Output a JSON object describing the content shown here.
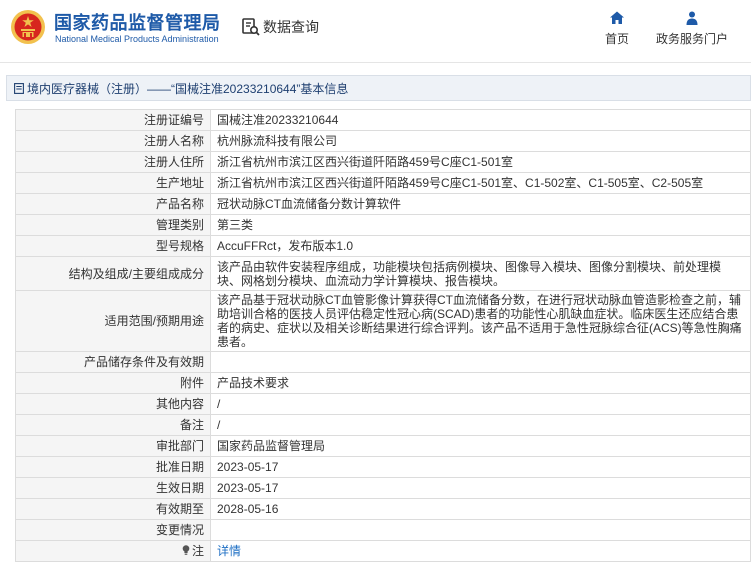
{
  "header": {
    "brand_cn": "国家药品监督管理局",
    "brand_en": "National Medical Products Administration",
    "data_query_label": "数据查询",
    "nav": [
      {
        "label": "首页",
        "icon": "home-icon"
      },
      {
        "label": "政务服务门户",
        "icon": "user-icon"
      }
    ]
  },
  "breadcrumb": {
    "text": "境内医疗器械（注册）——“国械注准20233210644”基本信息"
  },
  "record": {
    "rows": [
      {
        "label": "注册证编号",
        "value": "国械注准20233210644"
      },
      {
        "label": "注册人名称",
        "value": "杭州脉流科技有限公司"
      },
      {
        "label": "注册人住所",
        "value": "浙江省杭州市滨江区西兴街道阡陌路459号C座C1-501室"
      },
      {
        "label": "生产地址",
        "value": "浙江省杭州市滨江区西兴街道阡陌路459号C座C1-501室、C1-502室、C1-505室、C2-505室"
      },
      {
        "label": "产品名称",
        "value": "冠状动脉CT血流储备分数计算软件"
      },
      {
        "label": "管理类别",
        "value": "第三类"
      },
      {
        "label": "型号规格",
        "value": "AccuFFRct，发布版本1.0"
      },
      {
        "label": "结构及组成/主要组成成分",
        "value": "该产品由软件安装程序组成，功能模块包括病例模块、图像导入模块、图像分割模块、前处理模块、网格划分模块、血流动力学计算模块、报告模块。"
      },
      {
        "label": "适用范围/预期用途",
        "value": "该产品基于冠状动脉CT血管影像计算获得CT血流储备分数，在进行冠状动脉血管造影检查之前，辅助培训合格的医技人员评估稳定性冠心病(SCAD)患者的功能性心肌缺血症状。临床医生还应结合患者的病史、症状以及相关诊断结果进行综合评判。该产品不适用于急性冠脉综合征(ACS)等急性胸痛患者。"
      },
      {
        "label": "产品储存条件及有效期",
        "value": ""
      },
      {
        "label": "附件",
        "value": "产品技术要求"
      },
      {
        "label": "其他内容",
        "value": "/"
      },
      {
        "label": "备注",
        "value": "/"
      },
      {
        "label": "审批部门",
        "value": "国家药品监督管理局"
      },
      {
        "label": "批准日期",
        "value": "2023-05-17"
      },
      {
        "label": "生效日期",
        "value": "2023-05-17"
      },
      {
        "label": "有效期至",
        "value": "2028-05-16"
      },
      {
        "label": "变更情况",
        "value": ""
      }
    ],
    "note": {
      "label": "注",
      "link": "详情",
      "icon": "lightbulb-icon"
    }
  },
  "colors": {
    "brand_blue": "#1e5aa8",
    "emblem_red": "#d7261e",
    "emblem_gold": "#f2c14e",
    "link_blue": "#1e6fc4"
  }
}
